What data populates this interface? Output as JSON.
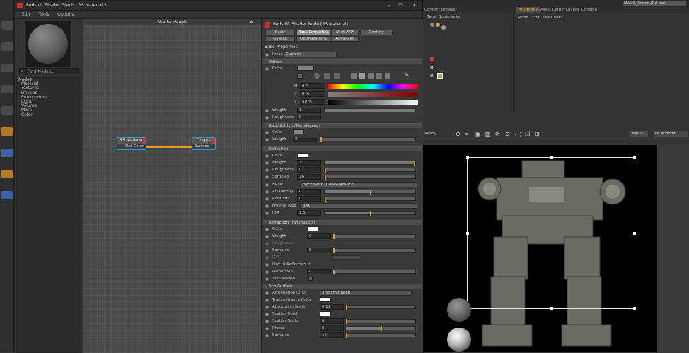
{
  "window": {
    "title": "Redshift Shader Graph - RS Material.3",
    "minimize": "–",
    "maximize": "☐",
    "close": "✕"
  },
  "menu": [
    "Edit",
    "Tools",
    "Options"
  ],
  "left_panel": {
    "find_placeholder": "Find Nodes...",
    "tree_header": "Nodes",
    "tree_items": [
      "Material",
      "Textures",
      "Utilities",
      "Environment",
      "Light",
      "Volume",
      "Math",
      "Color"
    ]
  },
  "graph": {
    "header": "Shader Graph",
    "node_material": {
      "title": "RS Material",
      "port": "Out Color"
    },
    "node_output": {
      "title": "Output",
      "port": "Surface"
    }
  },
  "props": {
    "title": "Redshift Shader Node [RS Material]",
    "tabs_row1": [
      "Basic",
      "Base Properties",
      "Multi-SSS",
      "Coating"
    ],
    "tabs_row2": [
      "Overall",
      "Optimizations",
      "Advanced"
    ],
    "section_base": "Base Properties",
    "preset_label": "Preset",
    "preset_value": "Custom",
    "diffuse": {
      "header": "Diffuse",
      "color_label": "Color",
      "h_label": "H",
      "h_value": "0 °",
      "s_label": "S",
      "s_value": "0 %",
      "v_label": "V",
      "v_value": "50 %",
      "weight_label": "Weight",
      "weight_value": "1",
      "roughness_label": "Roughness",
      "roughness_value": "0"
    },
    "backlighting": {
      "header": "Back-lighting/Translucency",
      "color_label": "Color",
      "weight_label": "Weight",
      "weight_value": "0"
    },
    "reflection": {
      "header": "Reflection",
      "color_label": "Color",
      "weight_label": "Weight",
      "weight_value": "1",
      "roughness_label": "Roughness",
      "roughness_value": "0",
      "samples_label": "Samples",
      "samples_value": "16",
      "brdf_label": "BRDF",
      "brdf_value": "Beckmann (Cook-Torrance)",
      "anisotropy_label": "Anisotropy",
      "anisotropy_value": "0",
      "rotation_label": "Rotation",
      "rotation_value": "0",
      "fresnel_label": "Fresnel Type",
      "fresnel_value": "IOR",
      "ior_label": "IOR",
      "ior_value": "1.5"
    },
    "refraction": {
      "header": "Refraction/Transmission",
      "color_label": "Color",
      "weight_label": "Weight",
      "weight_value": "0",
      "roughness_label": "Roughness",
      "samples_label": "Samples",
      "samples_value": "8",
      "ior_label": "IOR",
      "link_label": "Link to Reflection",
      "link_check": "✓",
      "dispersion_label": "Dispersion",
      "dispersion_value": "0",
      "thin_label": "Thin Walled"
    },
    "subsurface": {
      "header": "Sub-Surface",
      "units_label": "Attenuation Units",
      "units_value": "Transmittance",
      "tcolor_label": "Transmittance Color",
      "absorb_label": "Absorption Scale",
      "absorb_value": "0.01",
      "scoeff_label": "Scatter Coeff",
      "sscale_label": "Scatter Scale",
      "sscale_value": "0",
      "phase_label": "Phase",
      "phase_value": "0",
      "samples_label": "Samples",
      "samples_value": "16"
    }
  },
  "right": {
    "topbar_text": "Match_Scene-R (User)",
    "obj_tabs": [
      "Content Browser",
      "Tags",
      "Bookmarks"
    ],
    "attr_tabs": [
      "Attributes",
      "Asset Center",
      "Layers",
      "Console"
    ],
    "attr_menu": [
      "Mode",
      "Edit",
      "User Data"
    ],
    "tags_label": "Tags",
    "bookmarks_label": "Bookmarks",
    "vp_left": "Ready",
    "vp_zoom": "300 %",
    "vp_fit": "Fit Window"
  }
}
